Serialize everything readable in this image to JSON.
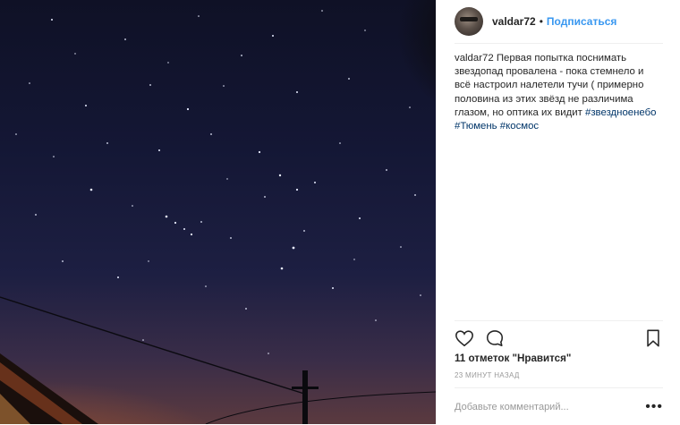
{
  "post": {
    "username": "valdar72",
    "separator": "•",
    "follow_label": "Подписаться",
    "caption": {
      "user": "valdar72",
      "text": "Первая попытка поснимать звездопад провалена - пока стемнело и всё настроил налетели тучи ( примерно половина из этих звёзд не различима глазом, но оптика их видит",
      "tags": [
        "#звездноенебо",
        "#Тюмень",
        "#космос"
      ]
    },
    "likes": {
      "count": "11",
      "word": "отметок",
      "label": "\"Нравится\""
    },
    "timestamp": "23 МИНУТ НАЗАД",
    "comment_placeholder": "Добавьте комментарий...",
    "more_label": "•••"
  },
  "icons": {
    "like": "heart-icon",
    "comment": "comment-bubble-icon",
    "bookmark": "bookmark-icon",
    "more": "more-options-icon"
  },
  "colors": {
    "link": "#3897f0",
    "hashtag": "#003569",
    "muted": "#999999",
    "text": "#262626",
    "divider": "#efefef"
  }
}
